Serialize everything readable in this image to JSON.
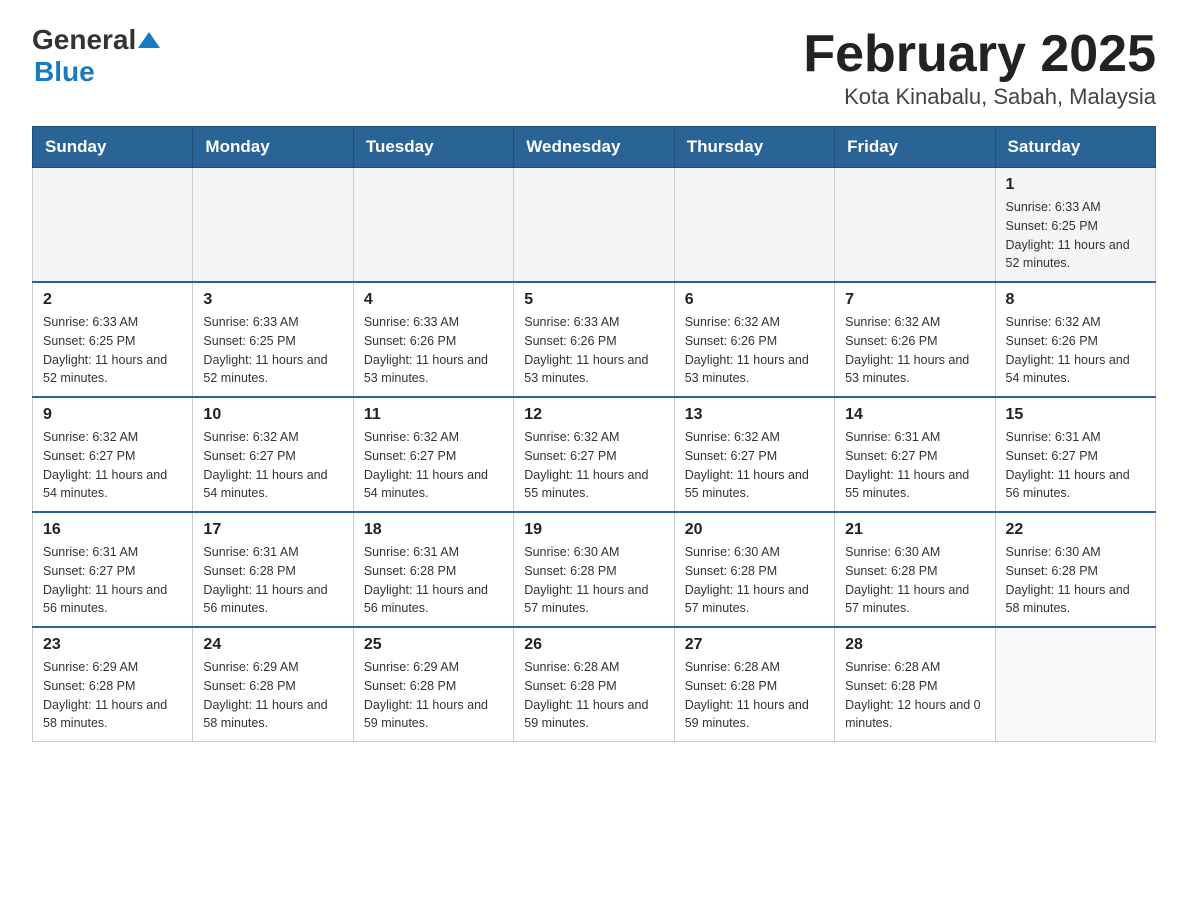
{
  "header": {
    "logo_general": "General",
    "logo_blue": "Blue",
    "title": "February 2025",
    "subtitle": "Kota Kinabalu, Sabah, Malaysia"
  },
  "weekdays": [
    "Sunday",
    "Monday",
    "Tuesday",
    "Wednesday",
    "Thursday",
    "Friday",
    "Saturday"
  ],
  "weeks": [
    [
      {
        "day": "",
        "info": ""
      },
      {
        "day": "",
        "info": ""
      },
      {
        "day": "",
        "info": ""
      },
      {
        "day": "",
        "info": ""
      },
      {
        "day": "",
        "info": ""
      },
      {
        "day": "",
        "info": ""
      },
      {
        "day": "1",
        "info": "Sunrise: 6:33 AM\nSunset: 6:25 PM\nDaylight: 11 hours and 52 minutes."
      }
    ],
    [
      {
        "day": "2",
        "info": "Sunrise: 6:33 AM\nSunset: 6:25 PM\nDaylight: 11 hours and 52 minutes."
      },
      {
        "day": "3",
        "info": "Sunrise: 6:33 AM\nSunset: 6:25 PM\nDaylight: 11 hours and 52 minutes."
      },
      {
        "day": "4",
        "info": "Sunrise: 6:33 AM\nSunset: 6:26 PM\nDaylight: 11 hours and 53 minutes."
      },
      {
        "day": "5",
        "info": "Sunrise: 6:33 AM\nSunset: 6:26 PM\nDaylight: 11 hours and 53 minutes."
      },
      {
        "day": "6",
        "info": "Sunrise: 6:32 AM\nSunset: 6:26 PM\nDaylight: 11 hours and 53 minutes."
      },
      {
        "day": "7",
        "info": "Sunrise: 6:32 AM\nSunset: 6:26 PM\nDaylight: 11 hours and 53 minutes."
      },
      {
        "day": "8",
        "info": "Sunrise: 6:32 AM\nSunset: 6:26 PM\nDaylight: 11 hours and 54 minutes."
      }
    ],
    [
      {
        "day": "9",
        "info": "Sunrise: 6:32 AM\nSunset: 6:27 PM\nDaylight: 11 hours and 54 minutes."
      },
      {
        "day": "10",
        "info": "Sunrise: 6:32 AM\nSunset: 6:27 PM\nDaylight: 11 hours and 54 minutes."
      },
      {
        "day": "11",
        "info": "Sunrise: 6:32 AM\nSunset: 6:27 PM\nDaylight: 11 hours and 54 minutes."
      },
      {
        "day": "12",
        "info": "Sunrise: 6:32 AM\nSunset: 6:27 PM\nDaylight: 11 hours and 55 minutes."
      },
      {
        "day": "13",
        "info": "Sunrise: 6:32 AM\nSunset: 6:27 PM\nDaylight: 11 hours and 55 minutes."
      },
      {
        "day": "14",
        "info": "Sunrise: 6:31 AM\nSunset: 6:27 PM\nDaylight: 11 hours and 55 minutes."
      },
      {
        "day": "15",
        "info": "Sunrise: 6:31 AM\nSunset: 6:27 PM\nDaylight: 11 hours and 56 minutes."
      }
    ],
    [
      {
        "day": "16",
        "info": "Sunrise: 6:31 AM\nSunset: 6:27 PM\nDaylight: 11 hours and 56 minutes."
      },
      {
        "day": "17",
        "info": "Sunrise: 6:31 AM\nSunset: 6:28 PM\nDaylight: 11 hours and 56 minutes."
      },
      {
        "day": "18",
        "info": "Sunrise: 6:31 AM\nSunset: 6:28 PM\nDaylight: 11 hours and 56 minutes."
      },
      {
        "day": "19",
        "info": "Sunrise: 6:30 AM\nSunset: 6:28 PM\nDaylight: 11 hours and 57 minutes."
      },
      {
        "day": "20",
        "info": "Sunrise: 6:30 AM\nSunset: 6:28 PM\nDaylight: 11 hours and 57 minutes."
      },
      {
        "day": "21",
        "info": "Sunrise: 6:30 AM\nSunset: 6:28 PM\nDaylight: 11 hours and 57 minutes."
      },
      {
        "day": "22",
        "info": "Sunrise: 6:30 AM\nSunset: 6:28 PM\nDaylight: 11 hours and 58 minutes."
      }
    ],
    [
      {
        "day": "23",
        "info": "Sunrise: 6:29 AM\nSunset: 6:28 PM\nDaylight: 11 hours and 58 minutes."
      },
      {
        "day": "24",
        "info": "Sunrise: 6:29 AM\nSunset: 6:28 PM\nDaylight: 11 hours and 58 minutes."
      },
      {
        "day": "25",
        "info": "Sunrise: 6:29 AM\nSunset: 6:28 PM\nDaylight: 11 hours and 59 minutes."
      },
      {
        "day": "26",
        "info": "Sunrise: 6:28 AM\nSunset: 6:28 PM\nDaylight: 11 hours and 59 minutes."
      },
      {
        "day": "27",
        "info": "Sunrise: 6:28 AM\nSunset: 6:28 PM\nDaylight: 11 hours and 59 minutes."
      },
      {
        "day": "28",
        "info": "Sunrise: 6:28 AM\nSunset: 6:28 PM\nDaylight: 12 hours and 0 minutes."
      },
      {
        "day": "",
        "info": ""
      }
    ]
  ]
}
